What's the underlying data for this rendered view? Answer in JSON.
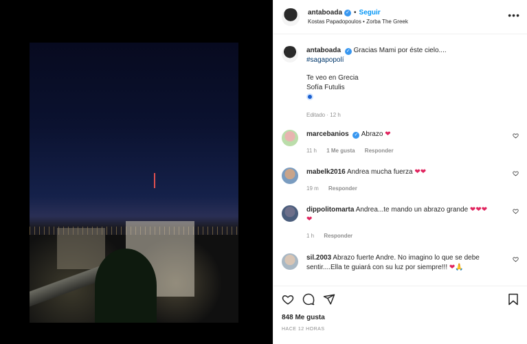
{
  "post": {
    "username": "antaboada",
    "follow_label": "Seguir",
    "audio_line": "Kostas Papadopoulos • Zorba The Greek",
    "caption": {
      "text": "Gracias Mami por éste cielo....",
      "hashtag": "#sagapopolí",
      "line2": "Te veo en Grecia",
      "line3": "Sofía Futulis",
      "meta": "Editado · 12 h"
    },
    "likes": "848 Me gusta",
    "time_ago": "HACE 12 HORAS"
  },
  "comments": [
    {
      "user": "marcebanios",
      "text": "Abrazo ❤",
      "time": "11 h",
      "likes": "1 Me gusta",
      "reply": "Responder"
    },
    {
      "user": "mabelk2016",
      "text": "Andrea mucha fuerza ❤❤",
      "time": "19 m",
      "reply": "Responder"
    },
    {
      "user": "dippolitomarta",
      "text": "Andrea...te mando un abrazo grande ❤❤❤",
      "text2": "❤",
      "time": "1 h",
      "reply": "Responder"
    },
    {
      "user": "sil.2003",
      "text": "Abrazo fuerte Andre. No imagino lo que se debe",
      "text2": "sentir....Ella te guiará con su luz por siempre!!! ❤🙏"
    }
  ],
  "icons": [
    "heart-icon",
    "comment-icon",
    "share-icon",
    "bookmark-icon",
    "more-options-icon",
    "verified-icon"
  ],
  "colors": {
    "follow": "#0095f6",
    "verified": "#3897f0",
    "muted": "#8e8e8e",
    "heart": "#e0245e"
  }
}
